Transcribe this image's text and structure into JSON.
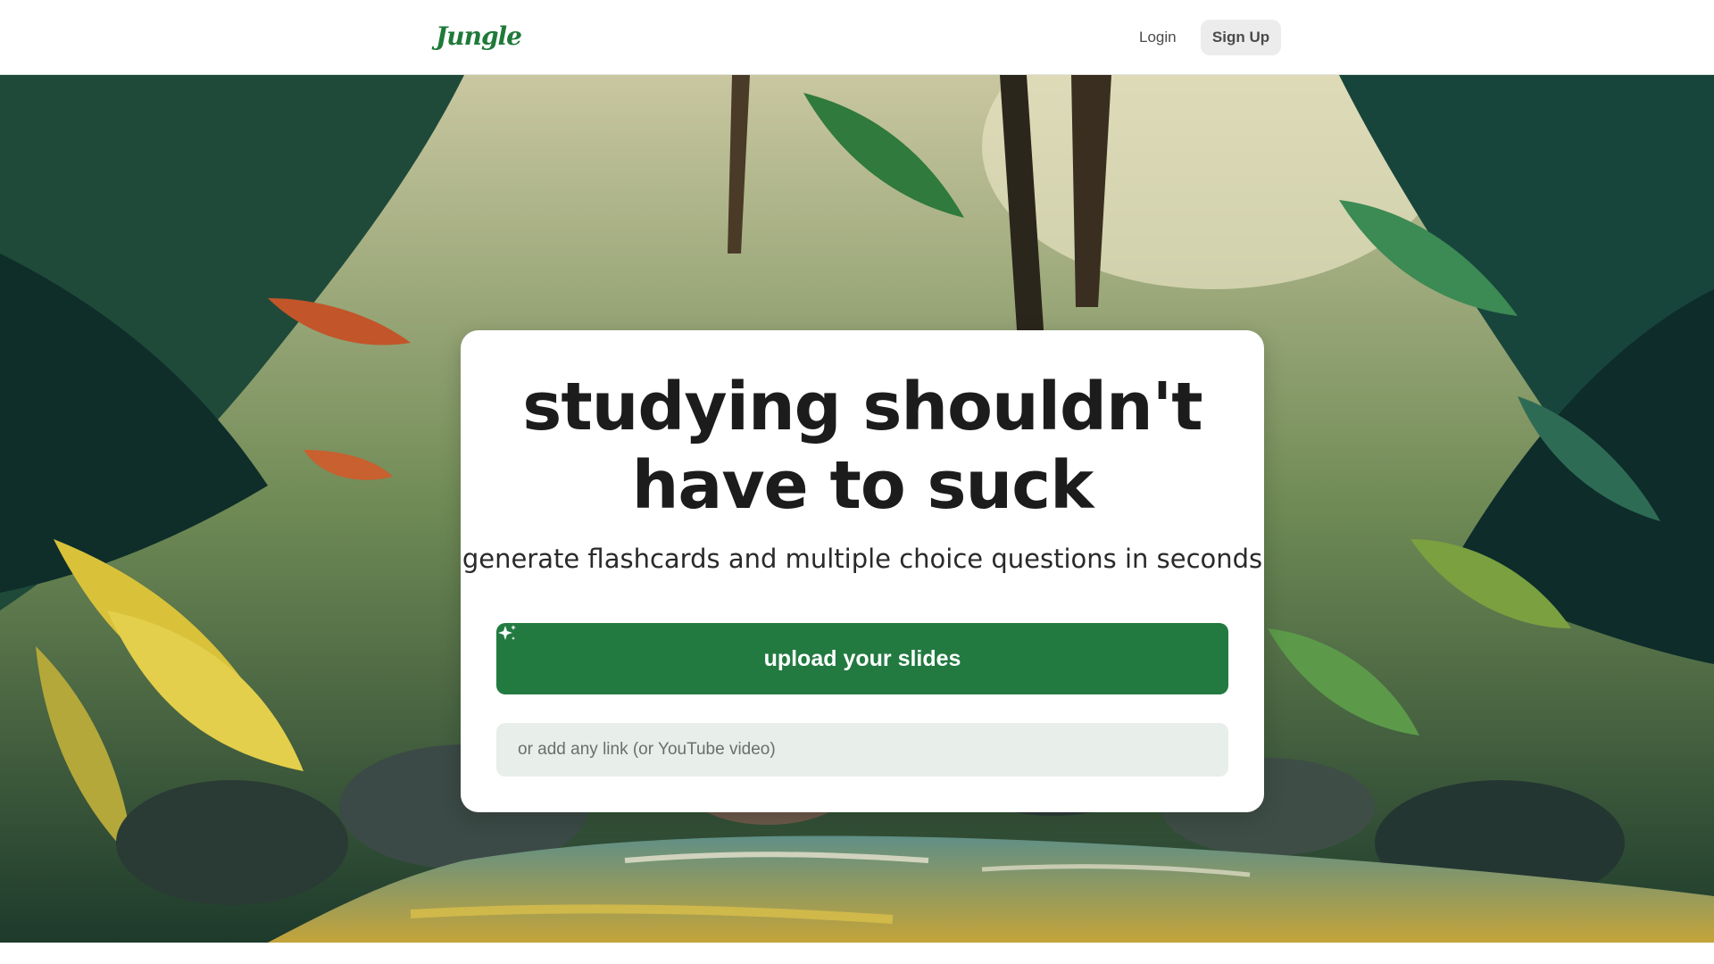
{
  "header": {
    "logo_text": "Jungle",
    "login_label": "Login",
    "signup_label": "Sign Up"
  },
  "hero": {
    "headline": "studying shouldn't have to suck",
    "subheadline": "generate flashcards and multiple choice questions in seconds",
    "upload_label": "upload your slides",
    "upload_icon": "sparkle-icon",
    "link_placeholder": "or add any link (or YouTube video)"
  },
  "colors": {
    "brand_green": "#227a41",
    "input_bg": "#e8eee9",
    "signup_bg": "#ececec"
  }
}
